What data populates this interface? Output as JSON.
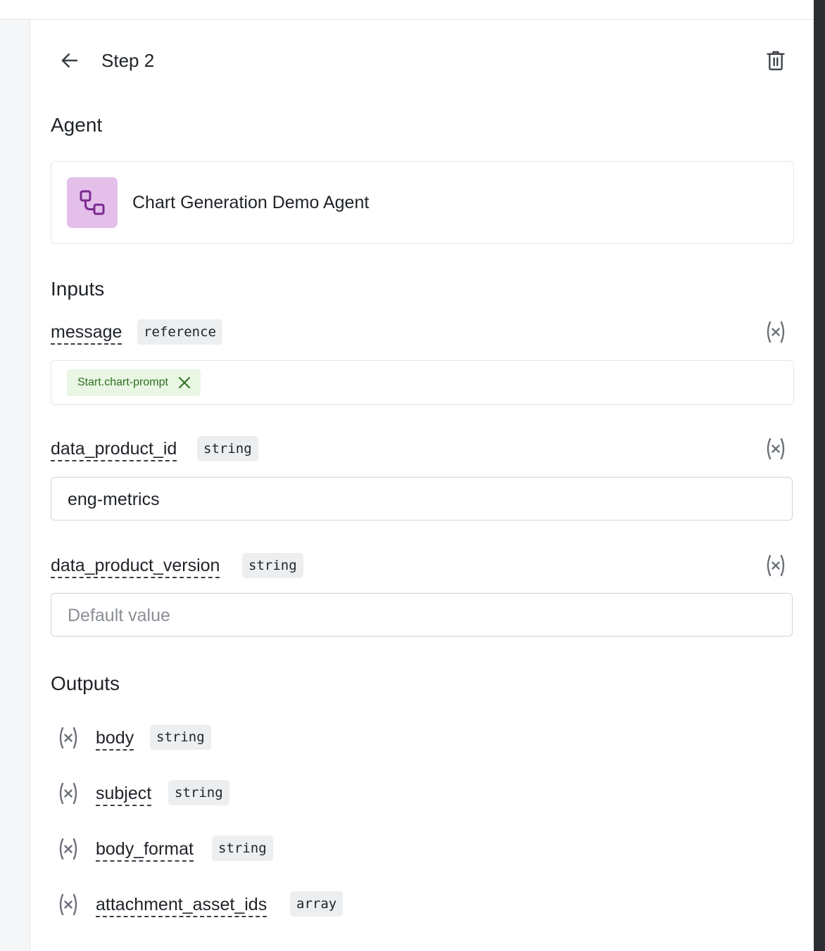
{
  "header": {
    "title": "Step 2",
    "back_icon": "arrow-left-icon",
    "delete_icon": "trash-icon"
  },
  "agent_section": {
    "title": "Agent",
    "agent_name": "Chart Generation Demo Agent",
    "agent_icon": "workflow-nodes-icon",
    "agent_icon_bg": "#e3bfea",
    "agent_icon_color": "#7b2a8d"
  },
  "inputs_section": {
    "title": "Inputs",
    "fields": [
      {
        "name": "message",
        "type": "reference",
        "reference_chip": "Start.chart-prompt"
      },
      {
        "name": "data_product_id",
        "type": "string",
        "value": "eng-metrics",
        "placeholder": "Default value"
      },
      {
        "name": "data_product_version",
        "type": "string",
        "value": "",
        "placeholder": "Default value"
      }
    ]
  },
  "outputs_section": {
    "title": "Outputs",
    "items": [
      {
        "name": "body",
        "type": "string"
      },
      {
        "name": "subject",
        "type": "string"
      },
      {
        "name": "body_format",
        "type": "string"
      },
      {
        "name": "attachment_asset_ids",
        "type": "array"
      }
    ]
  },
  "colors": {
    "reference_chip_bg": "#e8f6e3",
    "reference_chip_text": "#2e6f1f",
    "type_tag_bg": "#eceef0"
  }
}
